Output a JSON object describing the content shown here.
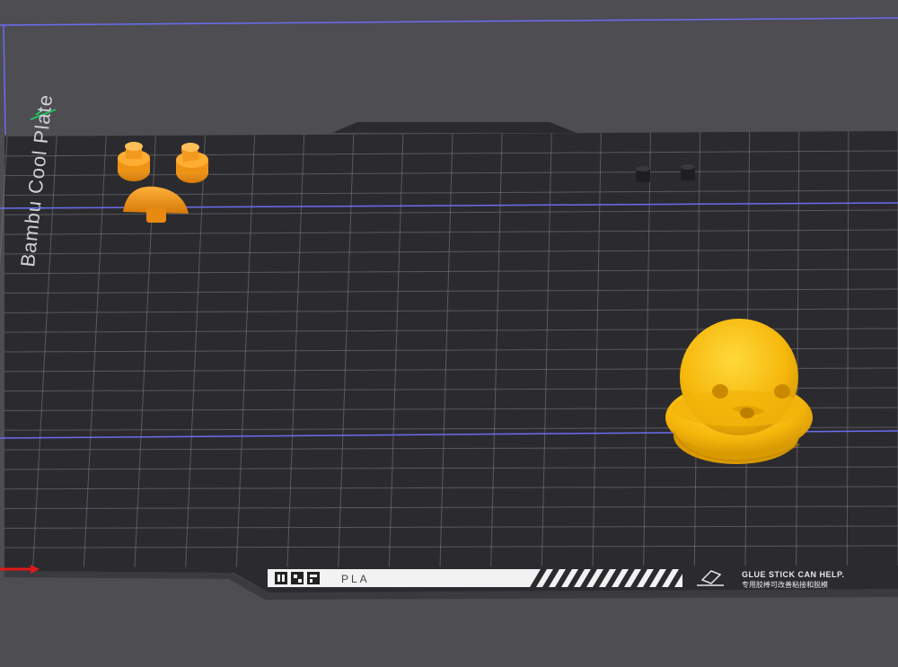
{
  "plate": {
    "name": "Bambu Cool Plate",
    "material": "PLA",
    "hint_en": "GLUE STICK CAN HELP.",
    "hint_cn": "专用胶棒可改善粘接和脱模"
  },
  "objects": [
    {
      "name": "small-peg-left",
      "color": "#f29a1c"
    },
    {
      "name": "small-peg-right",
      "color": "#f29a1c"
    },
    {
      "name": "dome-cap",
      "color": "#f29a1c"
    },
    {
      "name": "dark-pin-left",
      "color": "#1f1f22"
    },
    {
      "name": "dark-pin-right",
      "color": "#1f1f22"
    },
    {
      "name": "duck-head",
      "color": "#f6b80c"
    }
  ],
  "colors": {
    "background": "#4d4d52",
    "bed": "#2b2b2f",
    "grid": "#8a8a92",
    "bounding_line": "#6d6bf0",
    "axis_x": "#e0191b",
    "axis_y": "#1ec85c"
  }
}
